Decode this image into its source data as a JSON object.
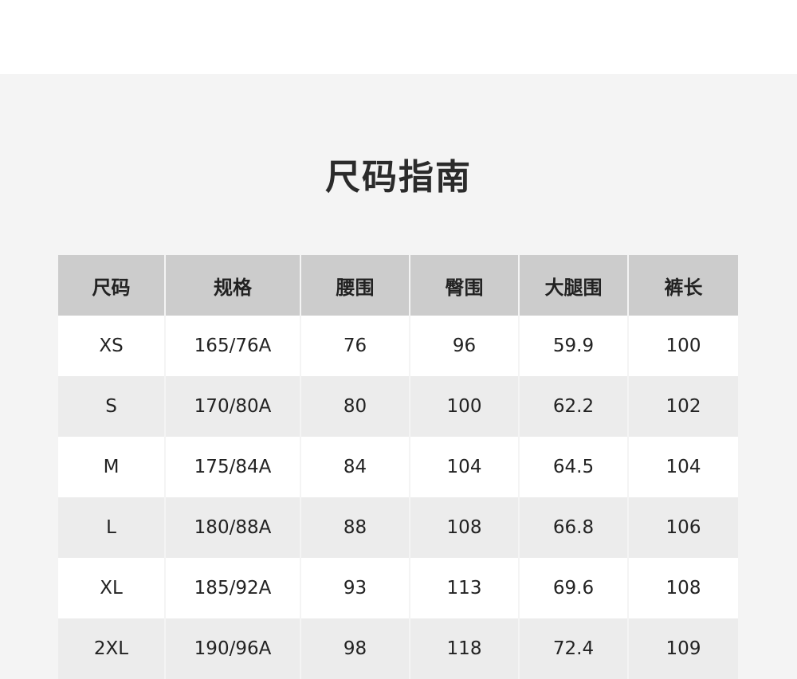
{
  "title": "尺码指南",
  "table": {
    "headers": [
      "尺码",
      "规格",
      "腰围",
      "臀围",
      "大腿围",
      "裤长"
    ],
    "rows": [
      [
        "XS",
        "165/76A",
        "76",
        "96",
        "59.9",
        "100"
      ],
      [
        "S",
        "170/80A",
        "80",
        "100",
        "62.2",
        "102"
      ],
      [
        "M",
        "175/84A",
        "84",
        "104",
        "64.5",
        "104"
      ],
      [
        "L",
        "180/88A",
        "88",
        "108",
        "66.8",
        "106"
      ],
      [
        "XL",
        "185/92A",
        "93",
        "113",
        "69.6",
        "108"
      ],
      [
        "2XL",
        "190/96A",
        "98",
        "118",
        "72.4",
        "109"
      ]
    ]
  },
  "colors": {
    "background": "#f4f4f4",
    "header_fill": "#cccccc",
    "row_light": "#ffffff",
    "row_alt": "#ececec",
    "text": "#222222"
  }
}
